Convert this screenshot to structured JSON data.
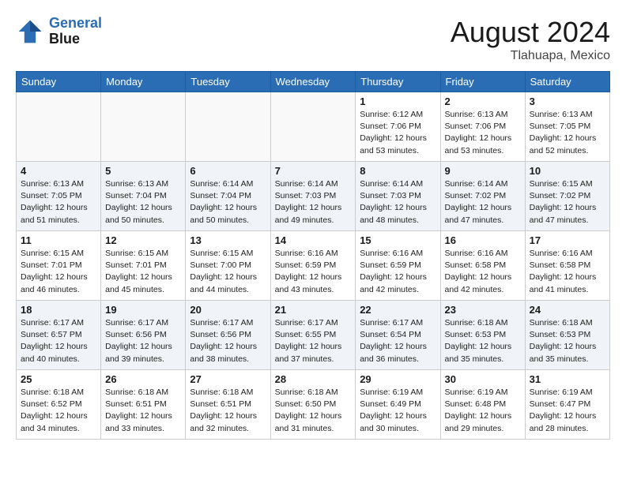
{
  "header": {
    "logo_line1": "General",
    "logo_line2": "Blue",
    "month": "August 2024",
    "location": "Tlahuapa, Mexico"
  },
  "weekdays": [
    "Sunday",
    "Monday",
    "Tuesday",
    "Wednesday",
    "Thursday",
    "Friday",
    "Saturday"
  ],
  "weeks": [
    [
      {
        "day": "",
        "info": ""
      },
      {
        "day": "",
        "info": ""
      },
      {
        "day": "",
        "info": ""
      },
      {
        "day": "",
        "info": ""
      },
      {
        "day": "1",
        "info": "Sunrise: 6:12 AM\nSunset: 7:06 PM\nDaylight: 12 hours\nand 53 minutes."
      },
      {
        "day": "2",
        "info": "Sunrise: 6:13 AM\nSunset: 7:06 PM\nDaylight: 12 hours\nand 53 minutes."
      },
      {
        "day": "3",
        "info": "Sunrise: 6:13 AM\nSunset: 7:05 PM\nDaylight: 12 hours\nand 52 minutes."
      }
    ],
    [
      {
        "day": "4",
        "info": "Sunrise: 6:13 AM\nSunset: 7:05 PM\nDaylight: 12 hours\nand 51 minutes."
      },
      {
        "day": "5",
        "info": "Sunrise: 6:13 AM\nSunset: 7:04 PM\nDaylight: 12 hours\nand 50 minutes."
      },
      {
        "day": "6",
        "info": "Sunrise: 6:14 AM\nSunset: 7:04 PM\nDaylight: 12 hours\nand 50 minutes."
      },
      {
        "day": "7",
        "info": "Sunrise: 6:14 AM\nSunset: 7:03 PM\nDaylight: 12 hours\nand 49 minutes."
      },
      {
        "day": "8",
        "info": "Sunrise: 6:14 AM\nSunset: 7:03 PM\nDaylight: 12 hours\nand 48 minutes."
      },
      {
        "day": "9",
        "info": "Sunrise: 6:14 AM\nSunset: 7:02 PM\nDaylight: 12 hours\nand 47 minutes."
      },
      {
        "day": "10",
        "info": "Sunrise: 6:15 AM\nSunset: 7:02 PM\nDaylight: 12 hours\nand 47 minutes."
      }
    ],
    [
      {
        "day": "11",
        "info": "Sunrise: 6:15 AM\nSunset: 7:01 PM\nDaylight: 12 hours\nand 46 minutes."
      },
      {
        "day": "12",
        "info": "Sunrise: 6:15 AM\nSunset: 7:01 PM\nDaylight: 12 hours\nand 45 minutes."
      },
      {
        "day": "13",
        "info": "Sunrise: 6:15 AM\nSunset: 7:00 PM\nDaylight: 12 hours\nand 44 minutes."
      },
      {
        "day": "14",
        "info": "Sunrise: 6:16 AM\nSunset: 6:59 PM\nDaylight: 12 hours\nand 43 minutes."
      },
      {
        "day": "15",
        "info": "Sunrise: 6:16 AM\nSunset: 6:59 PM\nDaylight: 12 hours\nand 42 minutes."
      },
      {
        "day": "16",
        "info": "Sunrise: 6:16 AM\nSunset: 6:58 PM\nDaylight: 12 hours\nand 42 minutes."
      },
      {
        "day": "17",
        "info": "Sunrise: 6:16 AM\nSunset: 6:58 PM\nDaylight: 12 hours\nand 41 minutes."
      }
    ],
    [
      {
        "day": "18",
        "info": "Sunrise: 6:17 AM\nSunset: 6:57 PM\nDaylight: 12 hours\nand 40 minutes."
      },
      {
        "day": "19",
        "info": "Sunrise: 6:17 AM\nSunset: 6:56 PM\nDaylight: 12 hours\nand 39 minutes."
      },
      {
        "day": "20",
        "info": "Sunrise: 6:17 AM\nSunset: 6:56 PM\nDaylight: 12 hours\nand 38 minutes."
      },
      {
        "day": "21",
        "info": "Sunrise: 6:17 AM\nSunset: 6:55 PM\nDaylight: 12 hours\nand 37 minutes."
      },
      {
        "day": "22",
        "info": "Sunrise: 6:17 AM\nSunset: 6:54 PM\nDaylight: 12 hours\nand 36 minutes."
      },
      {
        "day": "23",
        "info": "Sunrise: 6:18 AM\nSunset: 6:53 PM\nDaylight: 12 hours\nand 35 minutes."
      },
      {
        "day": "24",
        "info": "Sunrise: 6:18 AM\nSunset: 6:53 PM\nDaylight: 12 hours\nand 35 minutes."
      }
    ],
    [
      {
        "day": "25",
        "info": "Sunrise: 6:18 AM\nSunset: 6:52 PM\nDaylight: 12 hours\nand 34 minutes."
      },
      {
        "day": "26",
        "info": "Sunrise: 6:18 AM\nSunset: 6:51 PM\nDaylight: 12 hours\nand 33 minutes."
      },
      {
        "day": "27",
        "info": "Sunrise: 6:18 AM\nSunset: 6:51 PM\nDaylight: 12 hours\nand 32 minutes."
      },
      {
        "day": "28",
        "info": "Sunrise: 6:18 AM\nSunset: 6:50 PM\nDaylight: 12 hours\nand 31 minutes."
      },
      {
        "day": "29",
        "info": "Sunrise: 6:19 AM\nSunset: 6:49 PM\nDaylight: 12 hours\nand 30 minutes."
      },
      {
        "day": "30",
        "info": "Sunrise: 6:19 AM\nSunset: 6:48 PM\nDaylight: 12 hours\nand 29 minutes."
      },
      {
        "day": "31",
        "info": "Sunrise: 6:19 AM\nSunset: 6:47 PM\nDaylight: 12 hours\nand 28 minutes."
      }
    ]
  ]
}
